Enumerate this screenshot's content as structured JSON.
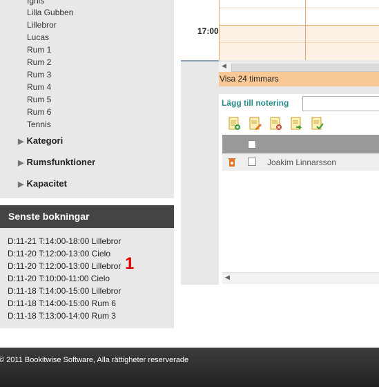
{
  "sidebar": {
    "rooms": [
      "Ignis",
      "Lilla Gubben",
      "Lillebror",
      "Lucas",
      "Rum 1",
      "Rum 2",
      "Rum 3",
      "Rum 4",
      "Rum 5",
      "Rum 6",
      "Tennis"
    ],
    "sections": [
      "Kategori",
      "Rumsfunktioner",
      "Kapacitet"
    ]
  },
  "recent": {
    "title": "Senste bokningar",
    "bookings": [
      "D:11-21 T:14:00-18:00 Lillebror",
      "D:11-20 T:12:00-13:00 Cielo",
      "D:11-20 T:12:00-13:00 Lillebror",
      "D:11-20 T:10:00-11:00 Cielo",
      "D:11-18 T:14:00-15:00 Lillebror",
      "D:11-18 T:14:00-15:00 Rum 6",
      "D:11-18 T:13:00-14:00 Rum 3"
    ],
    "marker": "1"
  },
  "calendar": {
    "time_label": "17:00",
    "visa_label": "Visa 24 timmars"
  },
  "notes": {
    "add_label": "Lägg till notering",
    "input_value": "",
    "toolbar_icons": [
      "add-note-icon",
      "edit-note-icon",
      "delete-note-icon",
      "move-note-icon",
      "approve-note-icon"
    ],
    "rows": [
      {
        "name": "Joakim Linnarsson",
        "icon": "delete-icon"
      }
    ]
  },
  "footer": {
    "copyright": "© 2011 Bookitwise Software, Alla rättigheter reserverade"
  }
}
